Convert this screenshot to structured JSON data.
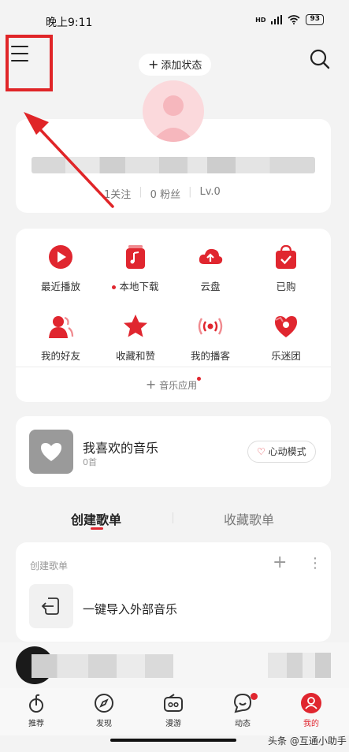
{
  "status_bar": {
    "time": "晚上9:11",
    "network": "HD",
    "battery": "93"
  },
  "header": {
    "menu_icon": "menu-icon",
    "add_status_label": "添加状态",
    "search_icon": "search-icon"
  },
  "profile": {
    "follow": "1关注",
    "fans": "0 粉丝",
    "level": "Lv.0"
  },
  "grid": {
    "items": [
      {
        "label": "最近播放",
        "icon": "recent-play-icon"
      },
      {
        "label": "本地下载",
        "icon": "local-download-icon"
      },
      {
        "label": "云盘",
        "icon": "cloud-disk-icon"
      },
      {
        "label": "已购",
        "icon": "purchased-icon"
      },
      {
        "label": "我的好友",
        "icon": "friends-icon"
      },
      {
        "label": "收藏和赞",
        "icon": "favorites-icon"
      },
      {
        "label": "我的播客",
        "icon": "podcast-icon"
      },
      {
        "label": "乐迷团",
        "icon": "fan-club-icon"
      }
    ],
    "music_app": "音乐应用"
  },
  "liked": {
    "title": "我喜欢的音乐",
    "count": "0首",
    "heart_mode": "心动模式"
  },
  "tabs": {
    "created": "创建歌单",
    "collected": "收藏歌单"
  },
  "playlist": {
    "header": "创建歌单",
    "import_label": "一键导入外部音乐"
  },
  "bottom_nav": [
    {
      "label": "推荐",
      "icon": "recommend-icon"
    },
    {
      "label": "发现",
      "icon": "discover-icon"
    },
    {
      "label": "漫游",
      "icon": "roam-icon"
    },
    {
      "label": "动态",
      "icon": "feed-icon"
    },
    {
      "label": "我的",
      "icon": "profile-icon"
    }
  ],
  "watermark": "头条 @互通小助手",
  "colors": {
    "accent": "#e0262f",
    "highlight": "#e02528",
    "background": "#f3f3f3"
  }
}
